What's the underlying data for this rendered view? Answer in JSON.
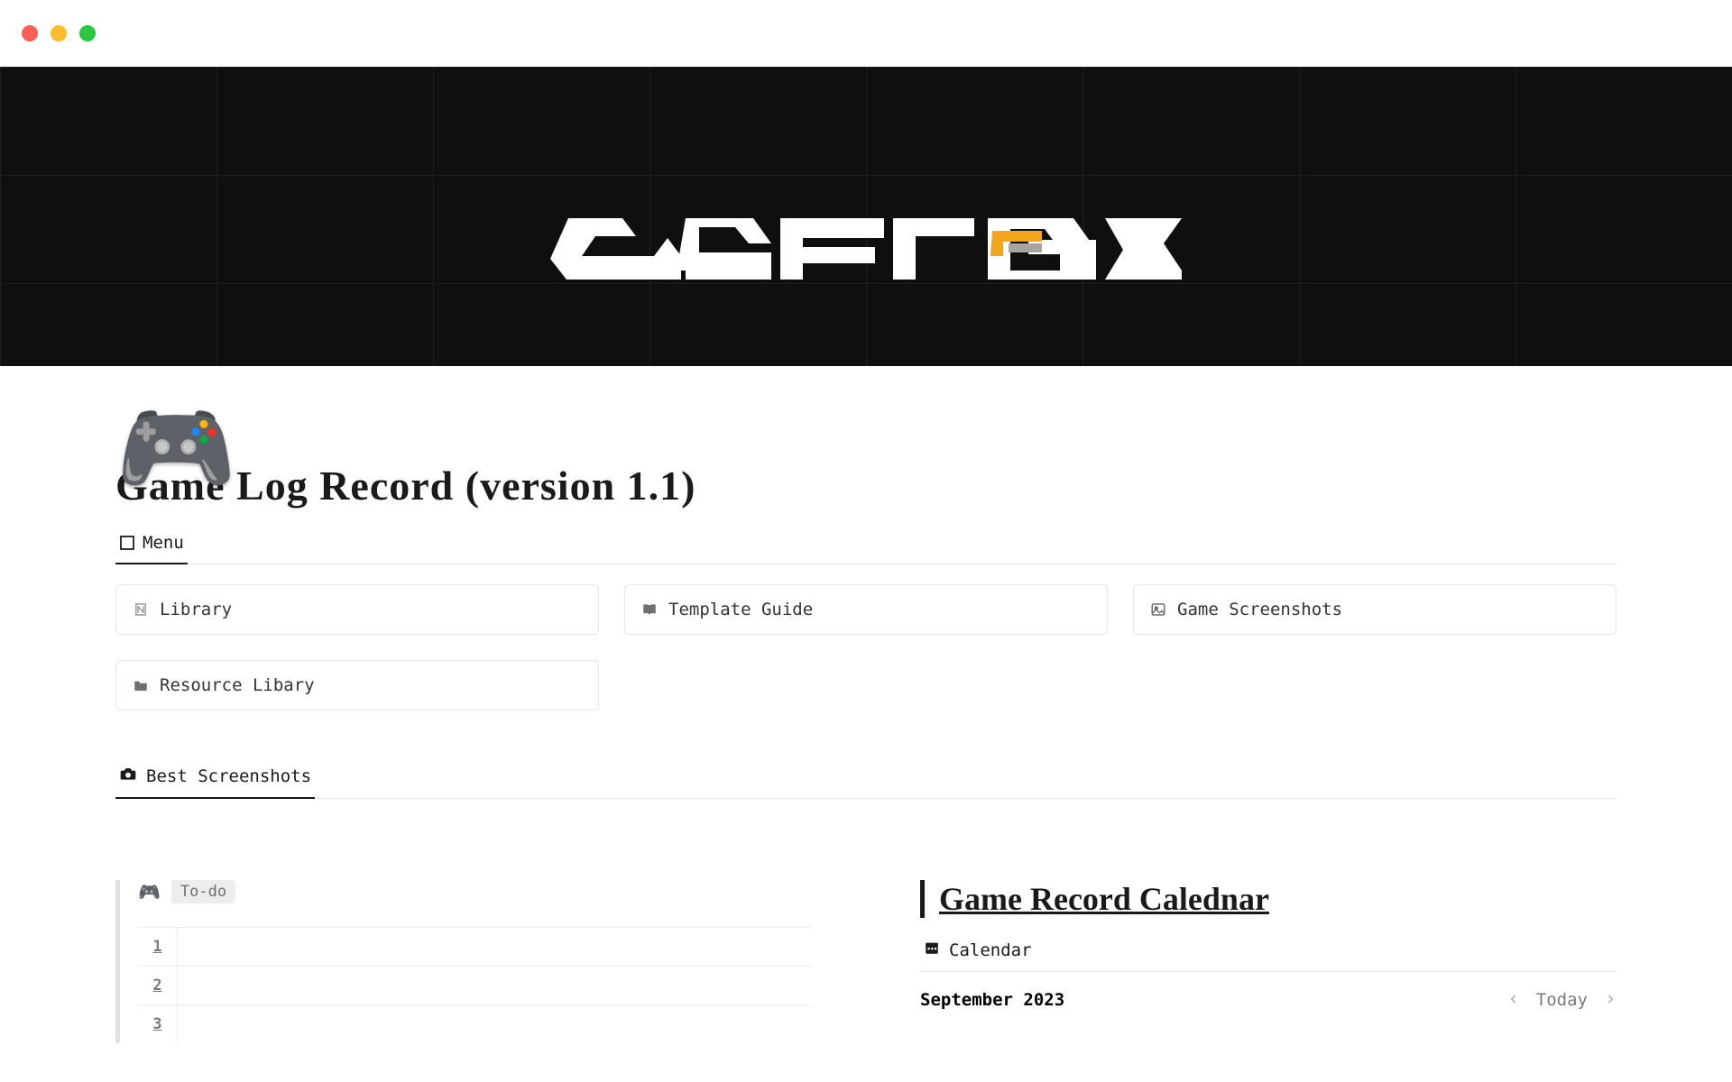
{
  "page": {
    "icon": "🎮",
    "title": "Game Log Record (version 1.1)"
  },
  "menu_tab": {
    "label": "Menu"
  },
  "cards": {
    "library": "Library",
    "template_guide": "Template Guide",
    "game_screenshots": "Game Screenshots",
    "resource_library": "Resource Libary"
  },
  "screenshots_tab": {
    "label": "Best Screenshots"
  },
  "todo": {
    "icon": "🎮",
    "tag": "To-do",
    "rows": [
      "1",
      "2",
      "3"
    ]
  },
  "calendar": {
    "title": "Game Record Calednar",
    "tab": "Calendar",
    "month": "September 2023",
    "today": "Today"
  },
  "colors": {
    "accent": "#f3a51d"
  }
}
